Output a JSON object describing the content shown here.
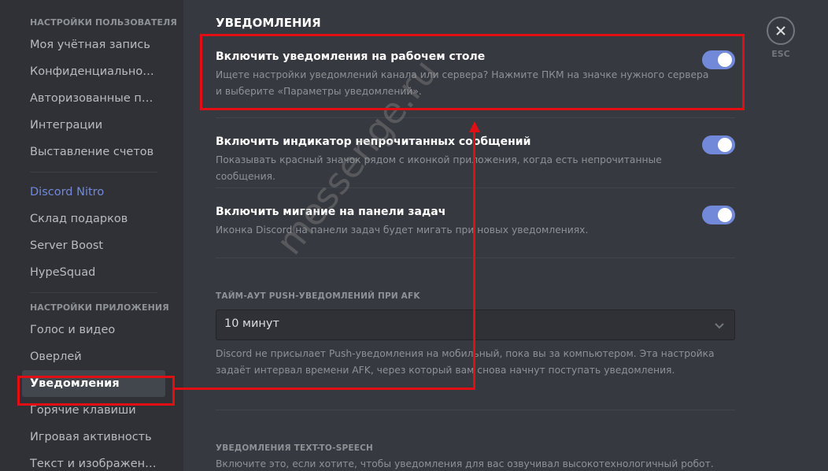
{
  "sidebar": {
    "user_settings_header": "Настройки пользователя",
    "user_items": [
      {
        "label": "Моя учётная запись"
      },
      {
        "label": "Конфиденциальность"
      },
      {
        "label": "Авторизованные приложения"
      },
      {
        "label": "Интеграции"
      },
      {
        "label": "Выставление счетов"
      }
    ],
    "nitro_items": [
      {
        "label": "Discord Nitro"
      },
      {
        "label": "Склад подарков"
      },
      {
        "label": "Server Boost"
      },
      {
        "label": "HypeSquad"
      }
    ],
    "app_settings_header": "Настройки приложения",
    "app_items": [
      {
        "label": "Голос и видео"
      },
      {
        "label": "Оверлей"
      },
      {
        "label": "Уведомления",
        "selected": true
      },
      {
        "label": "Горячие клавиши"
      },
      {
        "label": "Игровая активность"
      },
      {
        "label": "Текст и изображения"
      }
    ]
  },
  "main": {
    "title": "Уведомления",
    "settings": [
      {
        "title": "Включить уведомления на рабочем столе",
        "description": "Ищете настройки уведомлений канала или сервера? Нажмите ПКМ на значке нужного сервера и выберите «Параметры уведомлений».",
        "enabled": true
      },
      {
        "title": "Включить индикатор непрочитанных сообщений",
        "description": "Показывать красный значок рядом с иконкой приложения, когда есть непрочитанные сообщения.",
        "enabled": true
      },
      {
        "title": "Включить мигание на панели задач",
        "description": "Иконка Discord на панели задач будет мигать при новых уведомлениях.",
        "enabled": true
      }
    ],
    "afk": {
      "label": "Тайм-аут push-уведомлений при AFK",
      "selected_value": "10 минут",
      "description": "Discord не присылает Push-уведомления на мобильный, пока вы за компьютером. Эта настройка задаёт интервал времени AFK, через который вам снова начнут поступать уведомления."
    },
    "tts": {
      "label": "Уведомления Text-to-Speech",
      "description": "Включите это, если хотите, чтобы уведомления для вас озвучивал высокотехнологичный робот."
    }
  },
  "close": {
    "icon": "close-icon",
    "label": "ESC"
  },
  "watermark": "messenge.ru",
  "colors": {
    "accent": "#7289da",
    "annotation": "#e10f14",
    "background": "#36393f",
    "sidebar": "#2f3136"
  }
}
